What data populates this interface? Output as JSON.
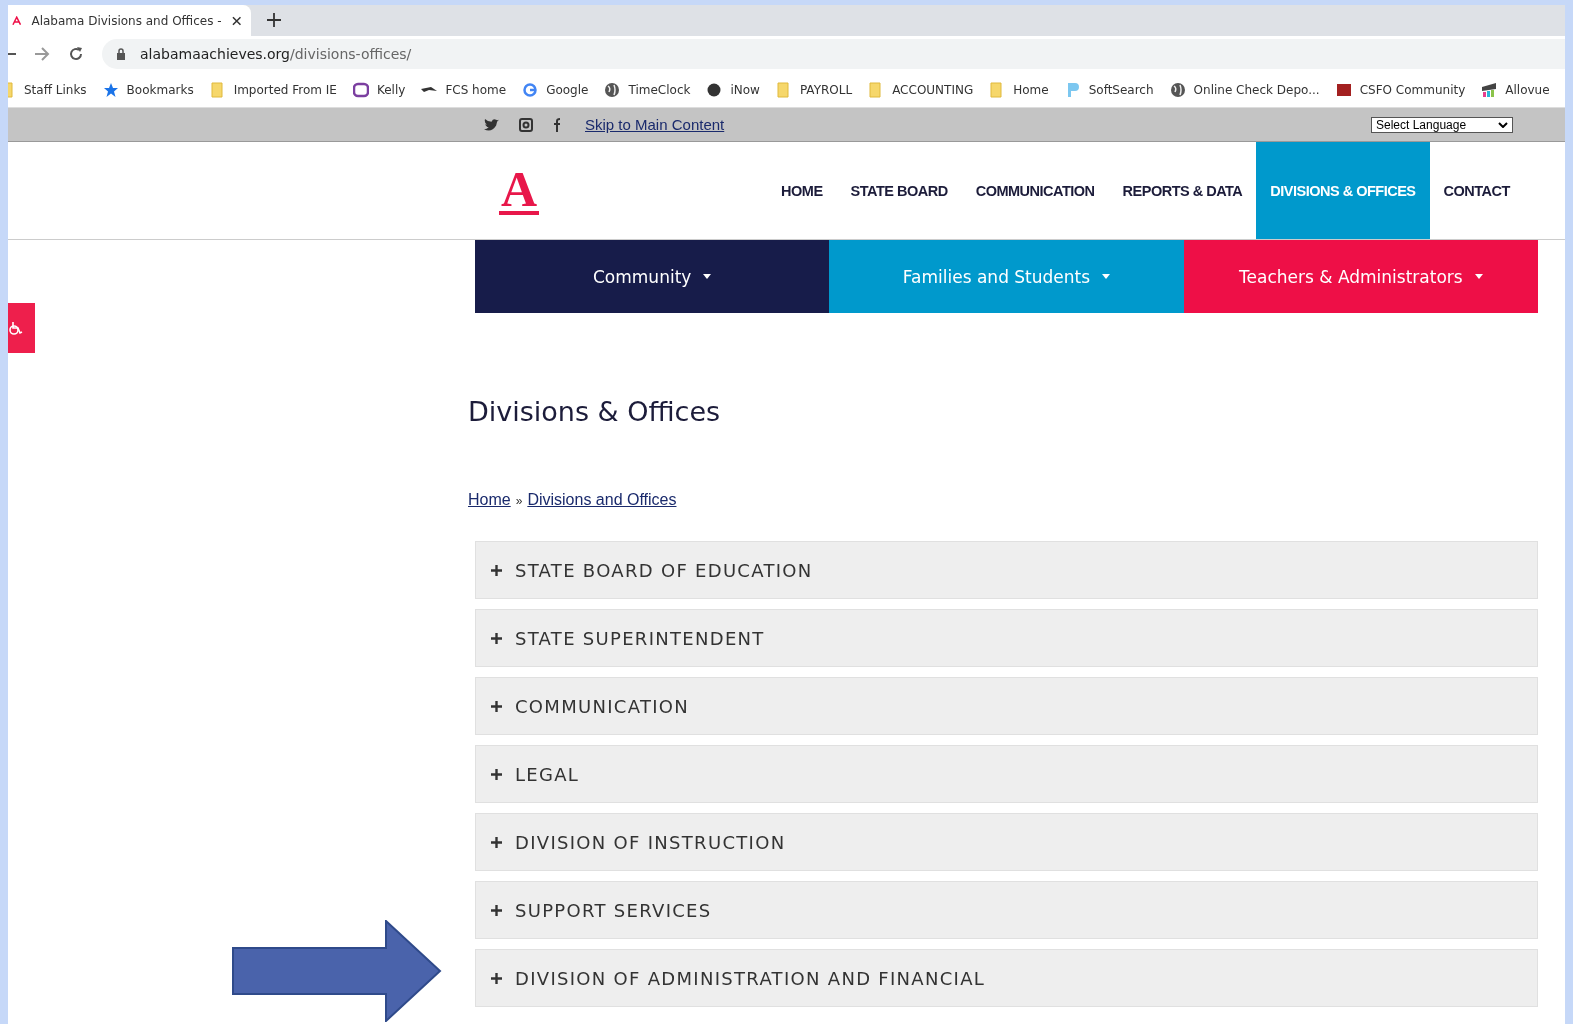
{
  "browser": {
    "tab": {
      "title": "Alabama Divisions and Offices -",
      "selected": true
    },
    "url_host": "alabamaachieves.org",
    "url_path": "/divisions-offices/",
    "bookmarks": [
      {
        "kind": "folder",
        "label": "Staff Links"
      },
      {
        "kind": "star",
        "label": "Bookmarks"
      },
      {
        "kind": "folder",
        "label": "Imported From IE"
      },
      {
        "kind": "purple",
        "label": "Kelly"
      },
      {
        "kind": "bird",
        "label": "FCS home"
      },
      {
        "kind": "google",
        "label": "Google"
      },
      {
        "kind": "globe",
        "label": "TimeClock"
      },
      {
        "kind": "dark",
        "label": "iNow"
      },
      {
        "kind": "folder",
        "label": "PAYROLL"
      },
      {
        "kind": "folder",
        "label": "ACCOUNTING"
      },
      {
        "kind": "folder",
        "label": "Home"
      },
      {
        "kind": "blue",
        "label": "SoftSearch"
      },
      {
        "kind": "globe",
        "label": "Online Check Depo..."
      },
      {
        "kind": "maroon",
        "label": "CSFO Community"
      },
      {
        "kind": "bars",
        "label": "Allovue"
      }
    ]
  },
  "utility_bar": {
    "skip_link": "Skip to Main Content",
    "language": "Select Language"
  },
  "header": {
    "logo": "A",
    "nav": [
      {
        "label": "HOME",
        "selected": false
      },
      {
        "label": "STATE BOARD",
        "selected": false
      },
      {
        "label": "COMMUNICATION",
        "selected": false
      },
      {
        "label": "REPORTS & DATA",
        "selected": false
      },
      {
        "label": "DIVISIONS & OFFICES",
        "selected": true
      },
      {
        "label": "CONTACT",
        "selected": false
      }
    ]
  },
  "audience_nav": [
    {
      "label": "Community",
      "color": "#171c4a"
    },
    {
      "label": "Families and Students",
      "color": "#0099cc"
    },
    {
      "label": "Teachers & Administrators",
      "color": "#ee0f47"
    }
  ],
  "page": {
    "title": "Divisions & Offices",
    "breadcrumb": [
      "Home",
      "Divisions and Offices"
    ],
    "breadcrumb_separator": "»",
    "sections": [
      {
        "label": "STATE BOARD OF EDUCATION",
        "expanded": false
      },
      {
        "label": "STATE SUPERINTENDENT",
        "expanded": false
      },
      {
        "label": "COMMUNICATION",
        "expanded": false
      },
      {
        "label": "LEGAL",
        "expanded": false
      },
      {
        "label": "DIVISION OF INSTRUCTION",
        "expanded": false
      },
      {
        "label": "SUPPORT SERVICES",
        "expanded": false
      },
      {
        "label": "DIVISION OF ADMINISTRATION AND FINANCIAL",
        "expanded": false
      }
    ]
  }
}
